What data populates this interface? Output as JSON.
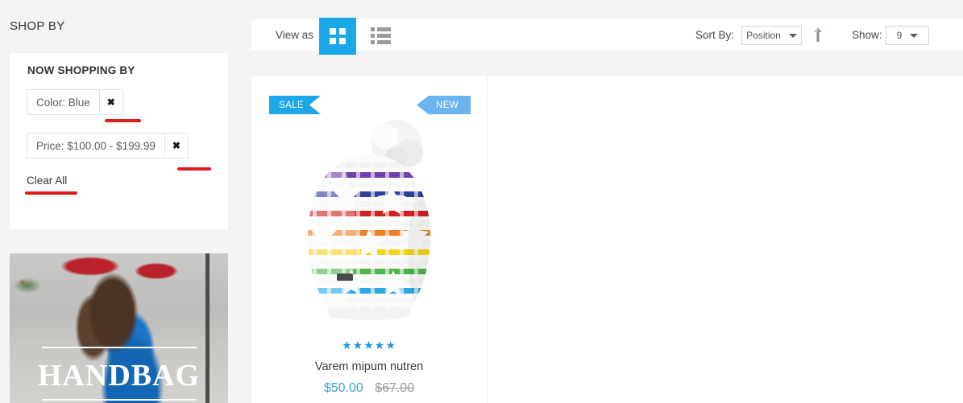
{
  "sidebar": {
    "shop_by_title": "SHOP BY",
    "filter_panel": {
      "title": "NOW SHOPPING BY",
      "chips": [
        {
          "label": "Color: Blue",
          "remove_icon": "close-icon",
          "remove_glyph": "✖"
        },
        {
          "label": "Price: $100.00 - $199.99",
          "remove_icon": "close-icon",
          "remove_glyph": "✖"
        }
      ],
      "clear_all_label": "Clear All"
    },
    "banner": {
      "word": "HANDBAG"
    }
  },
  "toolbar": {
    "view_as_label": "View as",
    "view_modes": [
      {
        "name": "grid-view",
        "icon": "grid-icon",
        "active": true
      },
      {
        "name": "list-view",
        "icon": "list-icon",
        "active": false
      }
    ],
    "sort_by_label": "Sort By:",
    "sort_by_value": "Position",
    "sort_direction_icon": "arrow-up-icon",
    "show_label": "Show:",
    "show_value": "9"
  },
  "products": [
    {
      "badges": [
        {
          "text": "SALE",
          "type": "sale"
        },
        {
          "text": "NEW",
          "type": "new"
        }
      ],
      "image_alt": "rainbow striped knit beanie with pom pom",
      "rating_stars": "★★★★★",
      "rating_count": 5,
      "name": "Varem mipum nutren",
      "price_special": "$50.00",
      "price_old": "$67.00"
    }
  ],
  "colors": {
    "accent_blue": "#1ca8e8",
    "badge_new_blue": "#6bb4ef",
    "annotation_red": "#e01b1b",
    "page_background": "#f4f4f4",
    "panel_white": "#ffffff",
    "price_special": "#3aa3dd",
    "price_old": "#9b9b9b"
  }
}
